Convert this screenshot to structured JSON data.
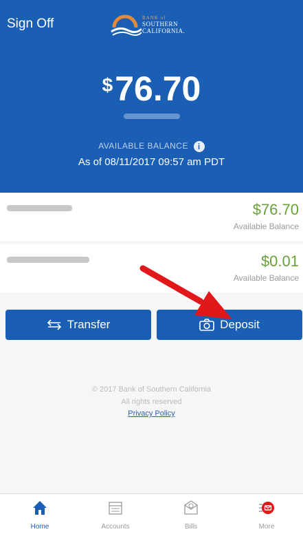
{
  "header": {
    "sign_off": "Sign Off",
    "logo_line1": "BANK of",
    "logo_line2": "SOUTHERN",
    "logo_line3": "CALIFORNIA."
  },
  "balance": {
    "currency": "$",
    "amount": "76.70",
    "available_label": "AVAILABLE BALANCE",
    "as_of": "As of  08/11/2017 09:57 am PDT"
  },
  "accounts": [
    {
      "amount": "$76.70",
      "label": "Available Balance"
    },
    {
      "amount": "$0.01",
      "label": "Available Balance"
    }
  ],
  "actions": {
    "transfer": "Transfer",
    "deposit": "Deposit"
  },
  "footer": {
    "copyright": "© 2017 Bank of Southern California",
    "rights": "All rights reserved",
    "privacy": "Privacy Policy"
  },
  "tabs": [
    {
      "label": "Home"
    },
    {
      "label": "Accounts"
    },
    {
      "label": "Bills"
    },
    {
      "label": "More"
    }
  ],
  "colors": {
    "brand_blue": "#1a5fb4",
    "positive_green": "#69a038",
    "annotation_red": "#e0181a"
  }
}
